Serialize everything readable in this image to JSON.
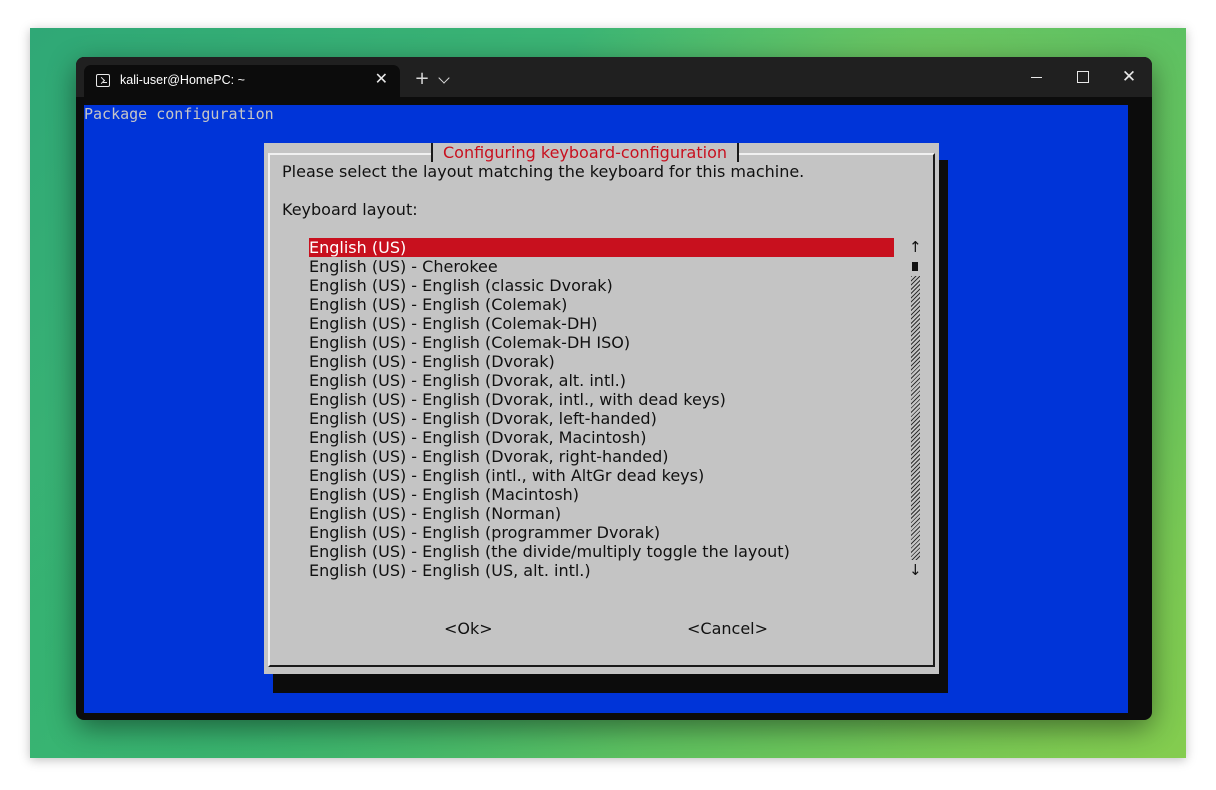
{
  "window": {
    "tab_title": "kali-user@HomePC: ~",
    "tab_close": "✕",
    "new_tab": "+",
    "close": "✕"
  },
  "terminal": {
    "header": "Package configuration"
  },
  "dialog": {
    "title": "Configuring keyboard-configuration",
    "prompt": "Please select the layout matching the keyboard for this machine.",
    "list_label": "Keyboard layout:",
    "scroll_up": "↑",
    "scroll_down": "↓",
    "items": [
      "English (US)",
      "English (US) - Cherokee",
      "English (US) - English (classic Dvorak)",
      "English (US) - English (Colemak)",
      "English (US) - English (Colemak-DH)",
      "English (US) - English (Colemak-DH ISO)",
      "English (US) - English (Dvorak)",
      "English (US) - English (Dvorak, alt. intl.)",
      "English (US) - English (Dvorak, intl., with dead keys)",
      "English (US) - English (Dvorak, left-handed)",
      "English (US) - English (Dvorak, Macintosh)",
      "English (US) - English (Dvorak, right-handed)",
      "English (US) - English (intl., with AltGr dead keys)",
      "English (US) - English (Macintosh)",
      "English (US) - English (Norman)",
      "English (US) - English (programmer Dvorak)",
      "English (US) - English (the divide/multiply toggle the layout)",
      "English (US) - English (US, alt. intl.)"
    ],
    "selected_index": 0,
    "ok_label": "<Ok>",
    "cancel_label": "<Cancel>"
  },
  "colors": {
    "terminal_bg": "#0034d8",
    "dialog_bg": "#c4c4c4",
    "accent_red": "#c8101e"
  }
}
